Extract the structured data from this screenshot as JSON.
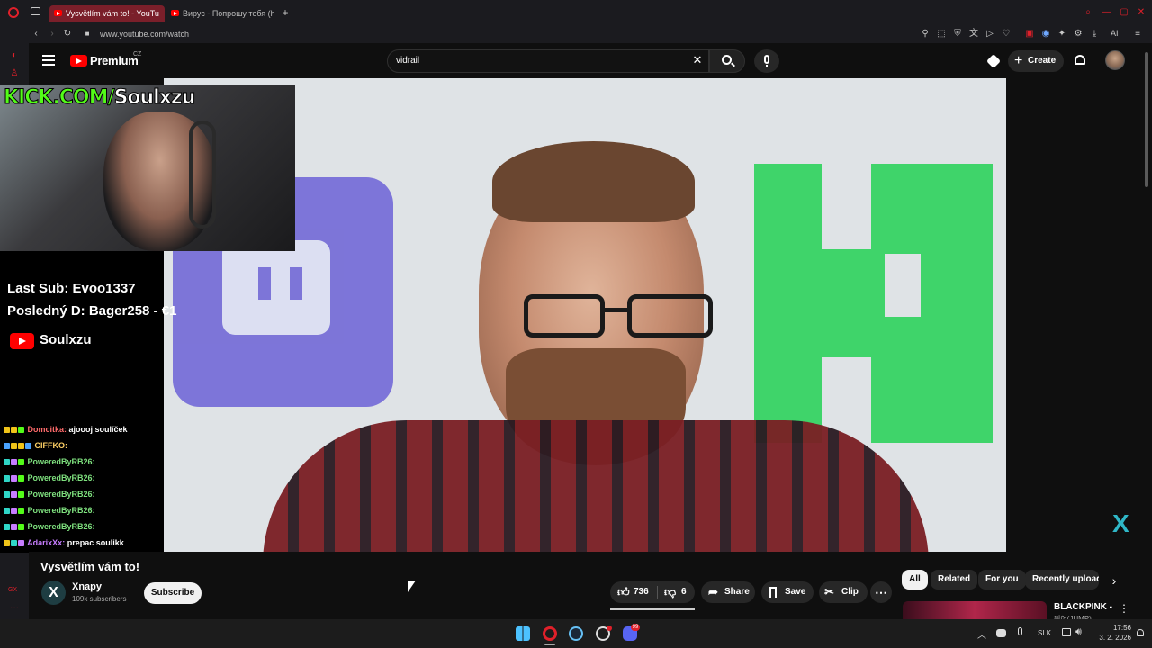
{
  "browser": {
    "tabs": [
      {
        "label": "Vysvětlím vám to! - YouTu",
        "active": true
      },
      {
        "label": "Вирус - Попрошу тебя (ha",
        "active": false
      }
    ],
    "new_tab": "+",
    "url": "www.youtube.com/watch",
    "ai_label": "AI"
  },
  "youtube": {
    "logo_text": "Premium",
    "region": "CZ",
    "search": {
      "value": "vidrail",
      "placeholder": "Search"
    },
    "create_label": "Create"
  },
  "stream_overlay": {
    "kick_text": "KICK.COM/",
    "channel_text": "Soulxzu",
    "last_sub": "Last Sub: Evoo1337",
    "last_donation": "Posledný D: Bager258 - €1",
    "yt_channel": "Soulxzu",
    "chat": [
      {
        "user": "Domcitka:",
        "message": "ajoooj soulíček",
        "color": "#ff6b6b"
      },
      {
        "user": "CIFFKO:",
        "message": "",
        "color": "#ffd166"
      },
      {
        "user": "PoweredByRB26:",
        "message": "",
        "color": "#7ee07e"
      },
      {
        "user": "PoweredByRB26:",
        "message": "",
        "color": "#7ee07e"
      },
      {
        "user": "PoweredByRB26:",
        "message": "",
        "color": "#7ee07e"
      },
      {
        "user": "PoweredByRB26:",
        "message": "",
        "color": "#7ee07e"
      },
      {
        "user": "PoweredByRB26:",
        "message": "",
        "color": "#7ee07e"
      },
      {
        "user": "AdarixXx:",
        "message": "prepac soulikk",
        "color": "#c77dff"
      }
    ]
  },
  "video": {
    "title": "Vysvětlím vám to!",
    "channel": "Xnapy",
    "subscribers": "109k subscribers",
    "subscribe_label": "Subscribe",
    "likes": "736",
    "dislikes": "6",
    "share_label": "Share",
    "save_label": "Save",
    "clip_label": "Clip",
    "watermark": "X"
  },
  "chips": [
    "All",
    "Related",
    "For you",
    "Recently uploade"
  ],
  "up_next": {
    "title": "BLACKPINK -",
    "subtitle": "뛰어(JUMP)"
  },
  "taskbar": {
    "lang": "SLK",
    "time": "17:56",
    "date": "3. 2. 2026",
    "discord_badge": "99"
  }
}
